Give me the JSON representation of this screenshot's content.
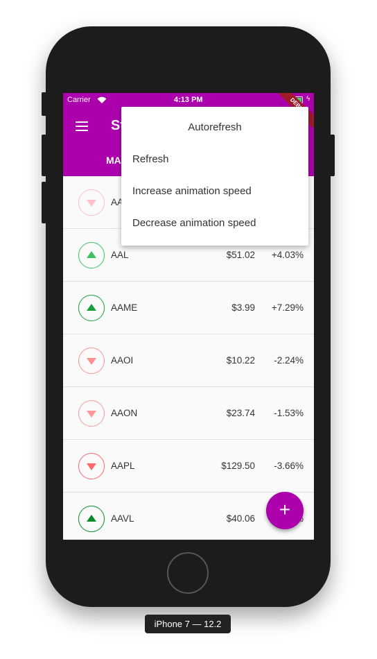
{
  "device_label": "iPhone 7 — 12.2",
  "status": {
    "carrier": "Carrier",
    "time": "4:13 PM"
  },
  "debug_banner": "DEBUG",
  "appbar": {
    "title": "Stocks",
    "tab": "MARKET"
  },
  "menu": {
    "items": [
      "Autorefresh",
      "Refresh",
      "Increase animation speed",
      "Decrease animation speed"
    ]
  },
  "stocks": [
    {
      "symbol": "AA",
      "price": "",
      "change": "",
      "direction": "down",
      "color": "#ffc0c8"
    },
    {
      "symbol": "AAL",
      "price": "$51.02",
      "change": "+4.03%",
      "direction": "up",
      "color": "#3cc060"
    },
    {
      "symbol": "AAME",
      "price": "$3.99",
      "change": "+7.29%",
      "direction": "up",
      "color": "#1a9e3a"
    },
    {
      "symbol": "AAOI",
      "price": "$10.22",
      "change": "-2.24%",
      "direction": "down",
      "color": "#ff9090"
    },
    {
      "symbol": "AAON",
      "price": "$23.74",
      "change": "-1.53%",
      "direction": "down",
      "color": "#ff9898"
    },
    {
      "symbol": "AAPL",
      "price": "$129.50",
      "change": "-3.66%",
      "direction": "down",
      "color": "#ff6868"
    },
    {
      "symbol": "AAVL",
      "price": "$40.06",
      "change": "%",
      "direction": "up",
      "color": "#0a8a2a"
    }
  ],
  "fab": {
    "label": "+"
  },
  "colors": {
    "primary": "#ad00ad"
  }
}
